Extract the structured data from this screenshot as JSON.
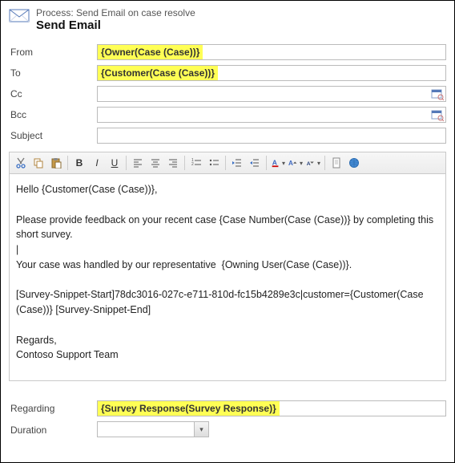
{
  "header": {
    "process_line": "Process: Send Email on case resolve",
    "title": "Send Email"
  },
  "fields": {
    "from": {
      "label": "From",
      "value": "{Owner(Case (Case))}"
    },
    "to": {
      "label": "To",
      "value": "{Customer(Case (Case))}"
    },
    "cc": {
      "label": "Cc",
      "value": ""
    },
    "bcc": {
      "label": "Bcc",
      "value": ""
    },
    "subject": {
      "label": "Subject",
      "value": ""
    },
    "regarding": {
      "label": "Regarding",
      "value": "{Survey Response(Survey Response)}"
    },
    "duration": {
      "label": "Duration",
      "value": ""
    }
  },
  "toolbar": {
    "cut": "Cut",
    "copy": "Copy",
    "paste": "Paste",
    "bold": "B",
    "italic": "I",
    "underline": "U",
    "align_left": "Align left",
    "align_center": "Align center",
    "align_right": "Align right",
    "ol": "Numbered list",
    "ul": "Bulleted list",
    "outdent": "Decrease indent",
    "indent": "Increase indent",
    "font_color": "Font color",
    "font_grow": "A",
    "font_shrink": "A",
    "insert": "Insert",
    "world": "Hyperlink"
  },
  "body": "Hello {Customer(Case (Case))},\n\nPlease provide feedback on your recent case {Case Number(Case (Case))} by completing this short survey.\n|\nYour case was handled by our representative  {Owning User(Case (Case))}.\n\n[Survey-Snippet-Start]78dc3016-027c-e711-810d-fc15b4289e3c|customer={Customer(Case (Case))} [Survey-Snippet-End]\n\nRegards,\nContoso Support Team"
}
